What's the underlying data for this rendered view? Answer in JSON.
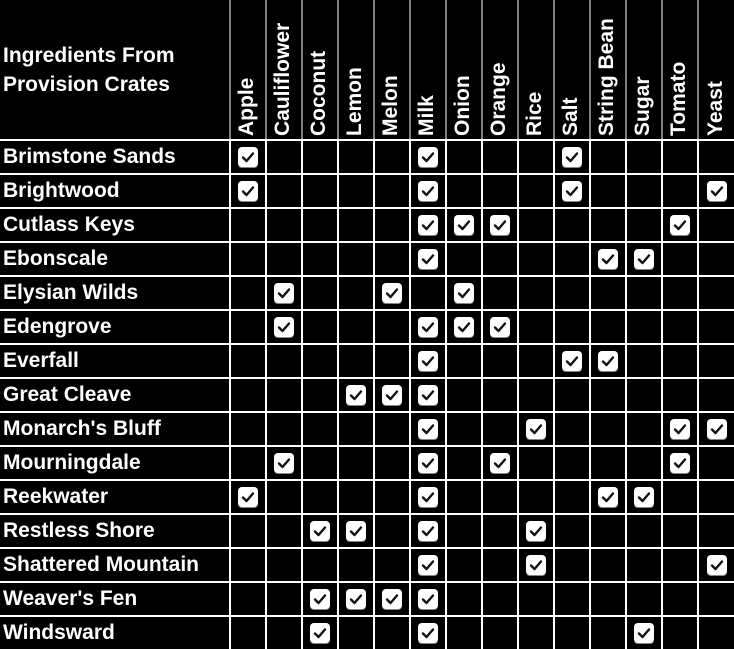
{
  "table": {
    "title": "Ingredients From Provision Crates",
    "title_line1": "Ingredients From",
    "title_line2": "Provision Crates",
    "ingredients": [
      "Apple",
      "Cauliflower",
      "Coconut",
      "Lemon",
      "Melon",
      "Milk",
      "Onion",
      "Orange",
      "Rice",
      "Salt",
      "String Bean",
      "Sugar",
      "Tomato",
      "Yeast"
    ],
    "rows": [
      {
        "name": "Brimstone Sands",
        "checked": [
          "Apple",
          "Milk",
          "Salt"
        ]
      },
      {
        "name": "Brightwood",
        "checked": [
          "Apple",
          "Milk",
          "Salt",
          "Yeast"
        ]
      },
      {
        "name": "Cutlass Keys",
        "checked": [
          "Milk",
          "Onion",
          "Orange",
          "Tomato"
        ]
      },
      {
        "name": "Ebonscale",
        "checked": [
          "Milk",
          "String Bean",
          "Sugar"
        ]
      },
      {
        "name": "Elysian Wilds",
        "checked": [
          "Cauliflower",
          "Melon",
          "Onion"
        ]
      },
      {
        "name": "Edengrove",
        "checked": [
          "Cauliflower",
          "Milk",
          "Onion",
          "Orange"
        ]
      },
      {
        "name": "Everfall",
        "checked": [
          "Milk",
          "Salt",
          "String Bean"
        ]
      },
      {
        "name": "Great Cleave",
        "checked": [
          "Lemon",
          "Melon",
          "Milk"
        ]
      },
      {
        "name": "Monarch's Bluff",
        "checked": [
          "Milk",
          "Rice",
          "Tomato",
          "Yeast"
        ]
      },
      {
        "name": "Mourningdale",
        "checked": [
          "Cauliflower",
          "Milk",
          "Orange",
          "Tomato"
        ]
      },
      {
        "name": "Reekwater",
        "checked": [
          "Apple",
          "Milk",
          "String Bean",
          "Sugar"
        ]
      },
      {
        "name": "Restless Shore",
        "checked": [
          "Coconut",
          "Lemon",
          "Milk",
          "Rice"
        ]
      },
      {
        "name": "Shattered Mountain",
        "checked": [
          "Milk",
          "Rice",
          "Yeast"
        ]
      },
      {
        "name": "Weaver's Fen",
        "checked": [
          "Coconut",
          "Lemon",
          "Melon",
          "Milk"
        ]
      },
      {
        "name": "Windsward",
        "checked": [
          "Coconut",
          "Milk",
          "Sugar"
        ]
      }
    ]
  },
  "icons": {
    "checked": "checkbox-checked-icon"
  },
  "colors": {
    "background": "#000000",
    "text": "#ffffff",
    "grid": "#ffffff",
    "header_divider": "#7f7f7f",
    "checkbox_bg": "#ffffff",
    "checkmark": "#111111"
  }
}
